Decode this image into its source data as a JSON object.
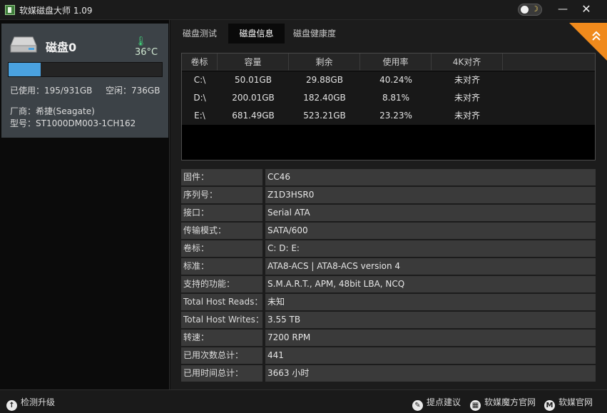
{
  "window": {
    "title": "软媒磁盘大师 1.09",
    "min_glyph": "—",
    "close_glyph": "✕"
  },
  "disk": {
    "name": "磁盘0",
    "temperature": "36°C",
    "used_fraction": 0.21,
    "used_text": "已使用：195/931GB",
    "free_text": "空闲：736GB",
    "manufacturer": "厂商：希捷(Seagate)",
    "model": "型号：ST1000DM003-1CH162"
  },
  "tabs": [
    "磁盘测试",
    "磁盘信息",
    "磁盘健康度"
  ],
  "active_tab": 1,
  "volume_table": {
    "headers": [
      "卷标",
      "容量",
      "剩余",
      "使用率",
      "4K对齐"
    ],
    "rows": [
      [
        "C:\\",
        "50.01GB",
        "29.88GB",
        "40.24%",
        "未对齐"
      ],
      [
        "D:\\",
        "200.01GB",
        "182.40GB",
        "8.81%",
        "未对齐"
      ],
      [
        "E:\\",
        "681.49GB",
        "523.21GB",
        "23.23%",
        "未对齐"
      ]
    ]
  },
  "info": [
    {
      "label": "固件：",
      "value": "CC46"
    },
    {
      "label": "序列号：",
      "value": "Z1D3HSR0"
    },
    {
      "label": "接口：",
      "value": "Serial ATA"
    },
    {
      "label": "传输模式：",
      "value": "SATA/600"
    },
    {
      "label": "卷标：",
      "value": "C: D: E:"
    },
    {
      "label": "标准：",
      "value": "ATA8-ACS | ATA8-ACS version 4"
    },
    {
      "label": "支持的功能：",
      "value": "S.M.A.R.T., APM, 48bit LBA, NCQ"
    },
    {
      "label": "Total Host Reads：",
      "value": "未知"
    },
    {
      "label": "Total Host Writes：",
      "value": "3.55 TB"
    },
    {
      "label": "转速：",
      "value": "7200 RPM"
    },
    {
      "label": "已用次数总计：",
      "value": "441"
    },
    {
      "label": "已用时间总计：",
      "value": "3663 小时"
    }
  ],
  "statusbar": {
    "update": "检测升级",
    "feedback": "提点建议",
    "mofang_site": "软媒魔方官网",
    "official_site": "软媒官网"
  },
  "colors": {
    "accent": "#4aa2e0",
    "corner": "#f08a1c",
    "temp": "#41d37a"
  },
  "icons": [
    "app-icon",
    "theme-toggle-icon",
    "minimize-icon",
    "close-icon",
    "disk-icon",
    "thermometer-icon",
    "corner-badge-icon",
    "upgrade-icon",
    "feedback-icon",
    "mofang-icon",
    "ruanmei-icon"
  ]
}
